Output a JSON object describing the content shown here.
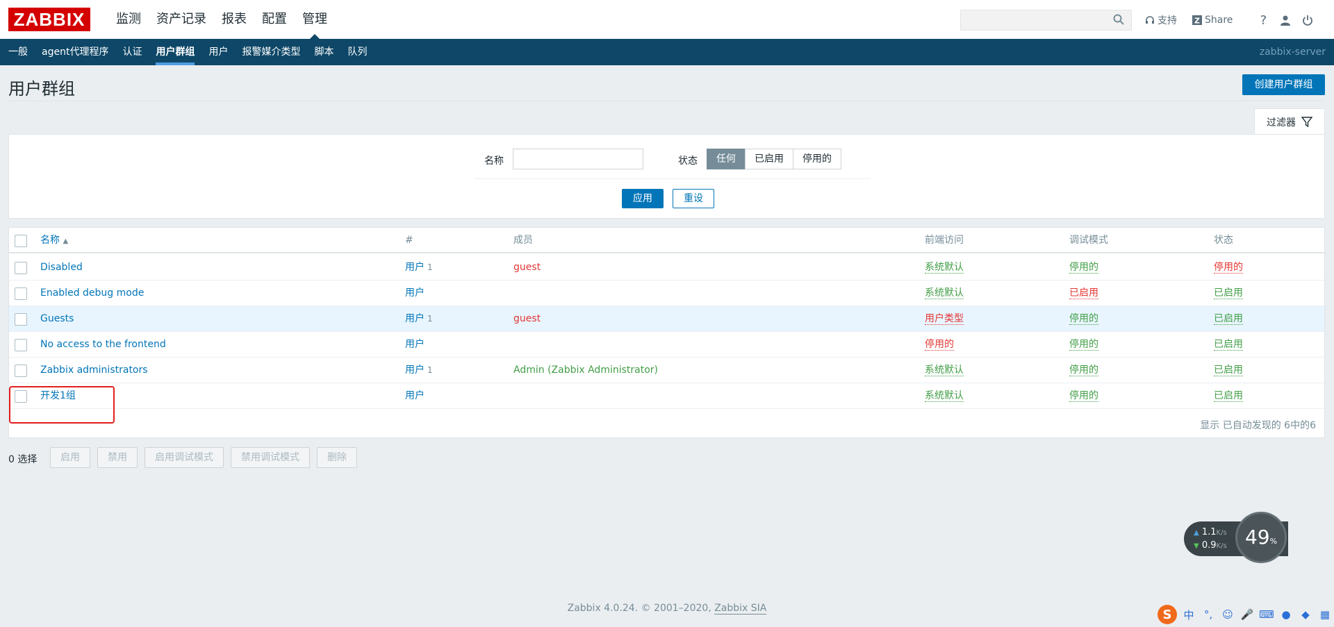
{
  "header": {
    "logo": "ZABBIX",
    "nav": [
      "监测",
      "资产记录",
      "报表",
      "配置",
      "管理"
    ],
    "active_nav": "管理",
    "support_label": "支持",
    "share_label": "Share",
    "help_label": "?"
  },
  "subnav": {
    "items": [
      "一般",
      "agent代理程序",
      "认证",
      "用户群组",
      "用户",
      "报警媒介类型",
      "脚本",
      "队列"
    ],
    "active": "用户群组",
    "server": "zabbix-server"
  },
  "page": {
    "title": "用户群组",
    "create_button": "创建用户群组"
  },
  "filter": {
    "tab_label": "过滤器",
    "name_label": "名称",
    "name_value": "",
    "status_label": "状态",
    "status_options": [
      "任何",
      "已启用",
      "停用的"
    ],
    "status_selected": "任何",
    "apply_label": "应用",
    "reset_label": "重设"
  },
  "table": {
    "headers": {
      "name": "名称",
      "sort_arrow": "▲",
      "count": "#",
      "members": "成员",
      "frontend": "前端访问",
      "debug": "调试模式",
      "status": "状态"
    },
    "rows": [
      {
        "name": "Disabled",
        "users_label": "用户",
        "count": "1",
        "members": "guest",
        "frontend": "系统默认",
        "debug": "停用的",
        "status": "停用的"
      },
      {
        "name": "Enabled debug mode",
        "users_label": "用户",
        "count": "",
        "members": "",
        "frontend": "系统默认",
        "debug": "已启用",
        "status": "已启用"
      },
      {
        "name": "Guests",
        "users_label": "用户",
        "count": "1",
        "members": "guest",
        "frontend": "用户类型",
        "debug": "停用的",
        "status": "已启用"
      },
      {
        "name": "No access to the frontend",
        "users_label": "用户",
        "count": "",
        "members": "",
        "frontend": "停用的",
        "debug": "停用的",
        "status": "已启用"
      },
      {
        "name": "Zabbix administrators",
        "users_label": "用户",
        "count": "1",
        "members": "Admin (Zabbix Administrator)",
        "frontend": "系统默认",
        "debug": "停用的",
        "status": "已启用"
      },
      {
        "name": "开发1组",
        "users_label": "用户",
        "count": "",
        "members": "",
        "frontend": "系统默认",
        "debug": "停用的",
        "status": "已启用"
      }
    ],
    "footer": "显示 已自动发现的 6中的6"
  },
  "actions": {
    "selected": "0 选择",
    "buttons": [
      "启用",
      "禁用",
      "启用调试模式",
      "禁用调试模式",
      "删除"
    ]
  },
  "speed_widget": {
    "up": "1.1",
    "down": "0.9",
    "unit": "K/s",
    "percent": "49",
    "percent_sign": "%"
  },
  "footer": {
    "text": "Zabbix 4.0.24. © 2001–2020, ",
    "link": "Zabbix SIA"
  },
  "ime": {
    "zh_label": "中"
  },
  "colors": {
    "brand_red": "#d40000",
    "nav_blue": "#0e4767",
    "link_blue": "#0275b8",
    "ok_green": "#429e47",
    "bad_red": "#e33734"
  }
}
